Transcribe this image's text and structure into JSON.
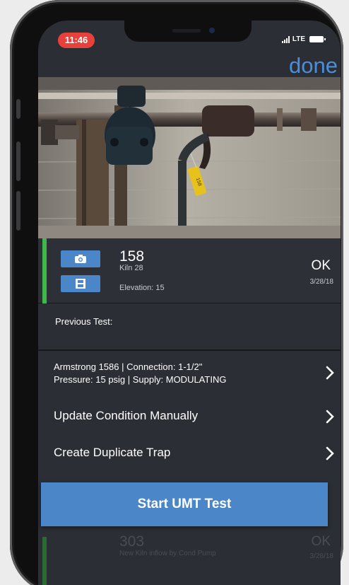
{
  "status_bar": {
    "time": "11:46",
    "network": "LTE"
  },
  "nav": {
    "done_label": "done"
  },
  "trap": {
    "id": "158",
    "location": "Kiln 28",
    "elevation": "Elevation: 15",
    "status": "OK",
    "date": "3/28/18",
    "tag_text": "158",
    "status_color": "#3fba4a"
  },
  "details": {
    "previous_test_label": "Previous Test:",
    "spec_line_1": "Armstrong 1586 | Connection: 1-1/2\"",
    "spec_line_2": "Pressure: 15 psig | Supply: MODULATING",
    "update_condition_label": "Update Condition Manually",
    "create_duplicate_label": "Create Duplicate Trap"
  },
  "actions": {
    "start_label": "Start UMT Test"
  },
  "background_item": {
    "id": "303",
    "description": "New Kiln inflow by Cond Pump",
    "status": "OK",
    "date": "3/28/18"
  },
  "colors": {
    "accent": "#4a86c8",
    "link": "#4a8fd8",
    "panel": "#2c2e36",
    "ok_green": "#3fba4a"
  },
  "icons": [
    "camera-icon",
    "film-icon",
    "chevron-right-icon",
    "signal-icon",
    "battery-icon"
  ]
}
